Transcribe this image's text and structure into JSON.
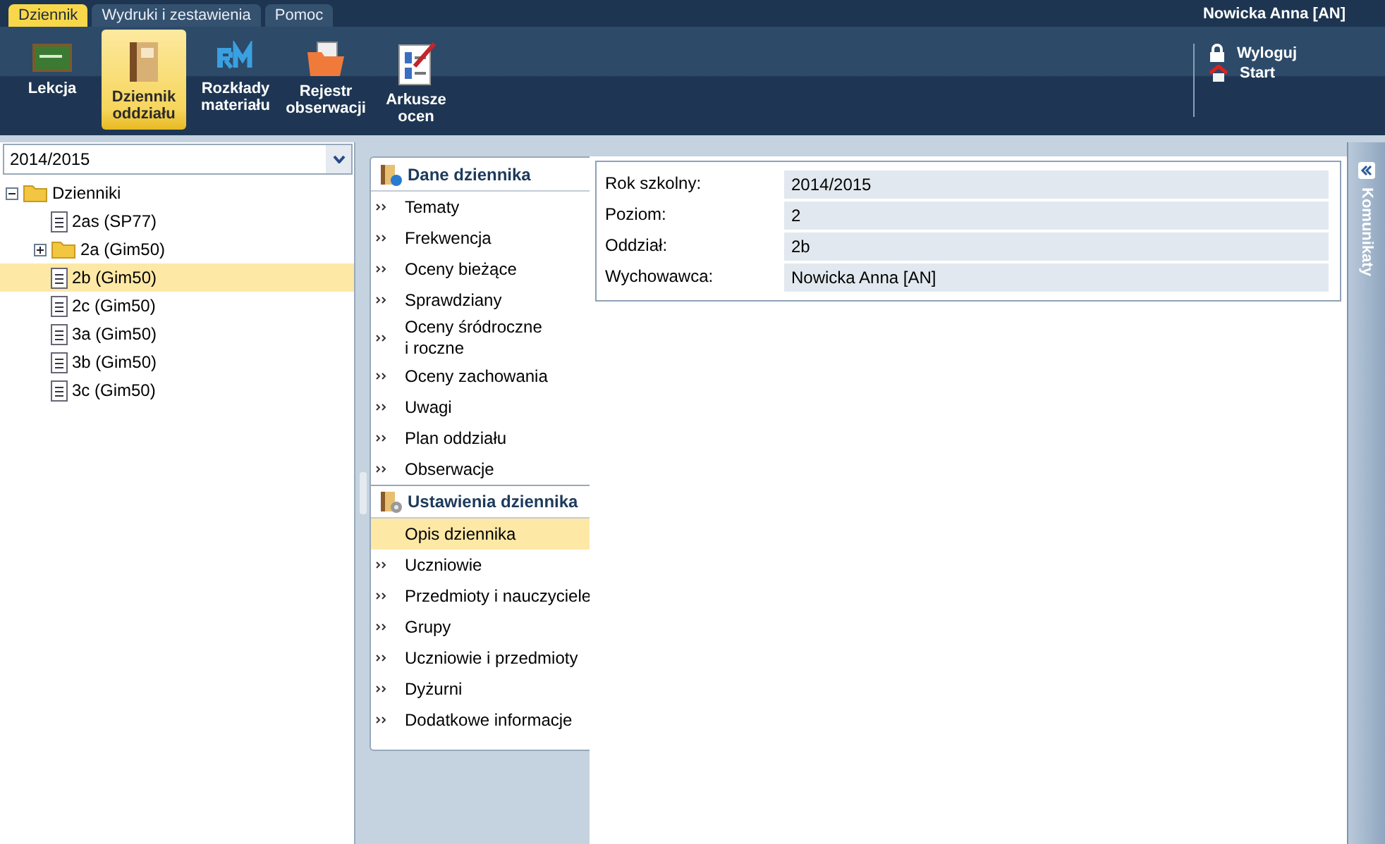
{
  "top_tabs": [
    {
      "label": "Dziennik",
      "selected": true
    },
    {
      "label": "Wydruki i zestawienia",
      "selected": false
    },
    {
      "label": "Pomoc",
      "selected": false
    }
  ],
  "user": "Nowicka Anna [AN]",
  "toolbar": [
    {
      "label": "Lekcja",
      "kind": "board",
      "selected": false
    },
    {
      "label": "Dziennik\noddziału",
      "kind": "book",
      "selected": true
    },
    {
      "label": "Rozkłady\nmateriału",
      "kind": "rm",
      "selected": false
    },
    {
      "label": "Rejestr\nobserwacji",
      "kind": "folder",
      "selected": false
    },
    {
      "label": "Arkusze\nocen",
      "kind": "sheet",
      "selected": false
    }
  ],
  "account_links": [
    {
      "label": "Wyloguj",
      "kind": "lock"
    },
    {
      "label": "Start",
      "kind": "home"
    }
  ],
  "year_select": {
    "value": "2014/2015"
  },
  "tree": [
    {
      "label": "Dzienniki",
      "kind": "folder",
      "expanded": true,
      "selected": false,
      "children": [
        {
          "label": "2as (SP77)",
          "kind": "doc",
          "selected": false
        },
        {
          "label": "2a (Gim50)",
          "kind": "folder",
          "expanded": false,
          "selected": false
        },
        {
          "label": "2b (Gim50)",
          "kind": "doc",
          "selected": true
        },
        {
          "label": "2c (Gim50)",
          "kind": "doc",
          "selected": false
        },
        {
          "label": "3a (Gim50)",
          "kind": "doc",
          "selected": false
        },
        {
          "label": "3b (Gim50)",
          "kind": "doc",
          "selected": false
        },
        {
          "label": "3c (Gim50)",
          "kind": "doc",
          "selected": false
        }
      ]
    }
  ],
  "nav_sections": [
    {
      "title": "Dane dziennika",
      "kind": "info",
      "items": [
        {
          "label": "Tematy",
          "selected": false
        },
        {
          "label": "Frekwencja",
          "selected": false
        },
        {
          "label": "Oceny bieżące",
          "selected": false
        },
        {
          "label": "Sprawdziany",
          "selected": false
        },
        {
          "label": "Oceny śródroczne\ni roczne",
          "selected": false
        },
        {
          "label": "Oceny zachowania",
          "selected": false
        },
        {
          "label": "Uwagi",
          "selected": false
        },
        {
          "label": "Plan oddziału",
          "selected": false
        },
        {
          "label": "Obserwacje",
          "selected": false
        }
      ]
    },
    {
      "title": "Ustawienia dziennika",
      "kind": "settings",
      "items": [
        {
          "label": "Opis dziennika",
          "selected": true
        },
        {
          "label": "Uczniowie",
          "selected": false
        },
        {
          "label": "Przedmioty i nauczyciele",
          "selected": false
        },
        {
          "label": "Grupy",
          "selected": false
        },
        {
          "label": "Uczniowie i przedmioty",
          "selected": false
        },
        {
          "label": "Dyżurni",
          "selected": false
        },
        {
          "label": "Dodatkowe informacje",
          "selected": false
        }
      ]
    }
  ],
  "details": [
    {
      "label": "Rok szkolny:",
      "value": "2014/2015"
    },
    {
      "label": "Poziom:",
      "value": "2"
    },
    {
      "label": "Oddział:",
      "value": "2b"
    },
    {
      "label": "Wychowawca:",
      "value": "Nowicka Anna [AN]"
    }
  ],
  "side_panel": {
    "title": "Komunikaty"
  }
}
